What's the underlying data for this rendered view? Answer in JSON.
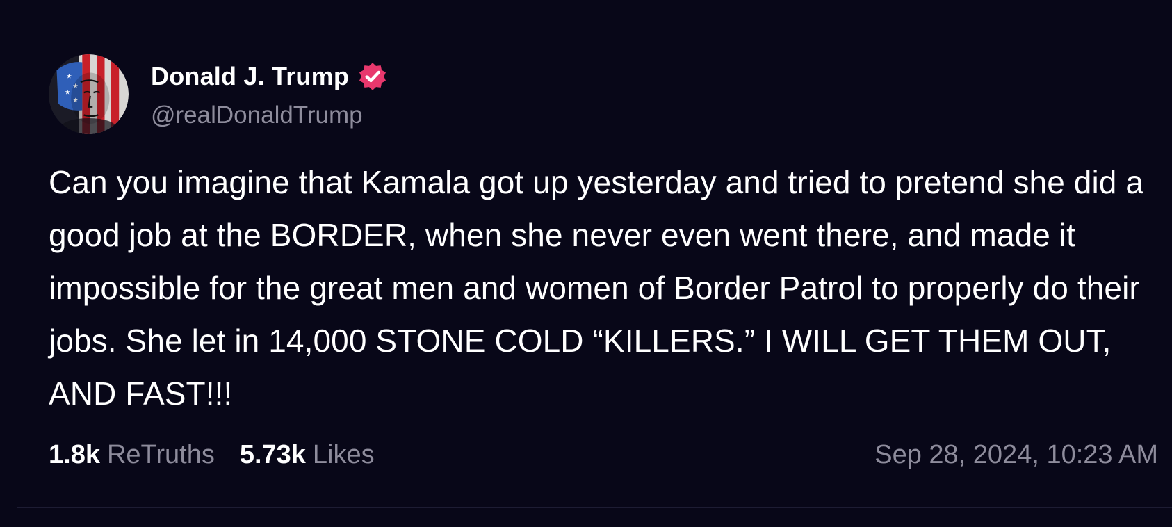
{
  "post": {
    "author": {
      "name": "Donald J. Trump",
      "handle": "@realDonaldTrump",
      "verified_color": "#e8386d"
    },
    "body": "Can you imagine that Kamala got up yesterday and tried to pretend she did a good job at the BORDER, when she never even went there, and made it impossible for the great men and women of Border Patrol to properly do their jobs. She let in 14,000 STONE COLD “KILLERS.” I WILL GET THEM OUT, AND FAST!!!",
    "stats": {
      "retruths_count": "1.8k",
      "retruths_label": "ReTruths",
      "likes_count": "5.73k",
      "likes_label": "Likes"
    },
    "timestamp": "Sep 28, 2024, 10:23 AM"
  },
  "colors": {
    "background": "#080718",
    "text": "#ffffff",
    "muted_text": "#8e8c9c",
    "accent": "#e8386d"
  }
}
